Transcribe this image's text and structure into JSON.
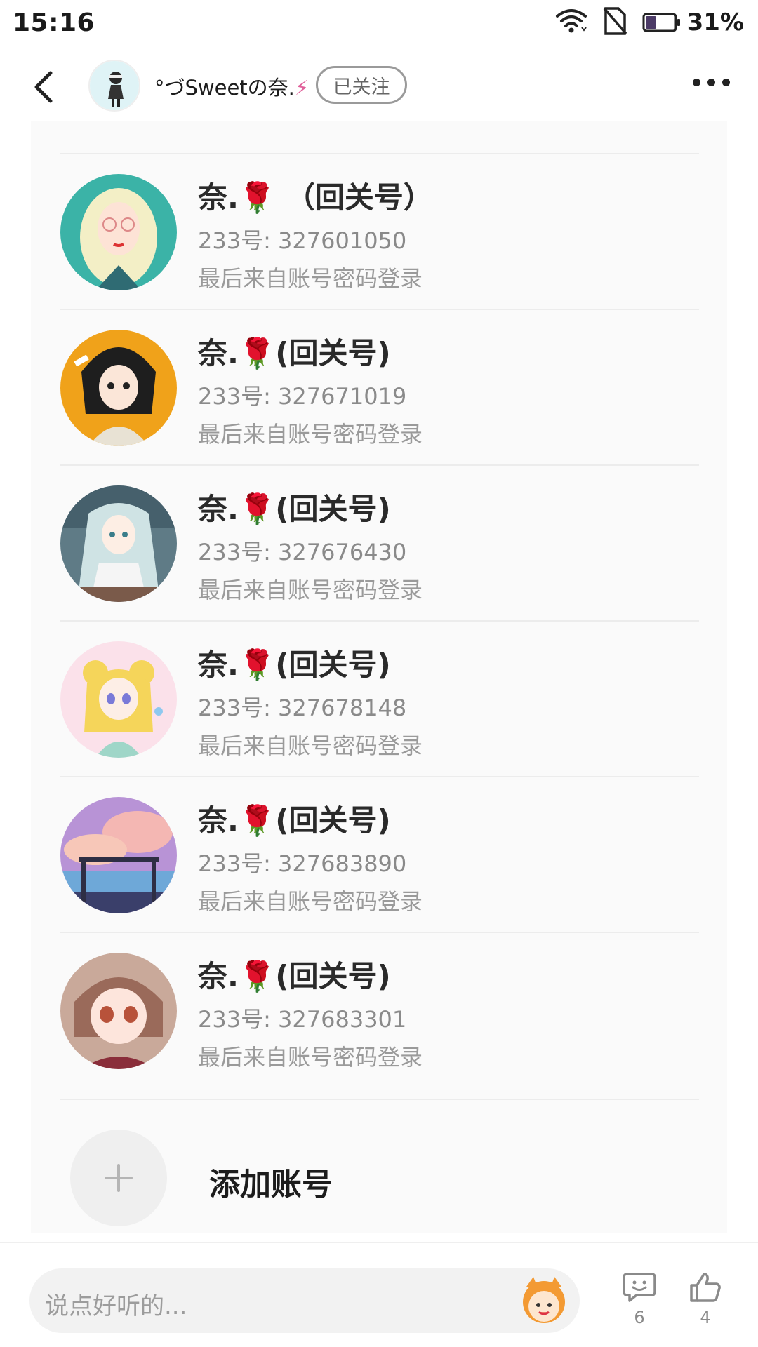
{
  "status_bar": {
    "time": "15:16",
    "battery_percent": "31%",
    "battery_level": 0.31,
    "icons": [
      "wifi-icon",
      "no-sim-icon",
      "battery-icon"
    ]
  },
  "header": {
    "user_name": "°づSweetの奈.",
    "follow_label": "已关注",
    "icons": [
      "back-arrow-icon",
      "more-dots-icon"
    ]
  },
  "accounts": [
    {
      "name": "奈.",
      "name_suffix": " （回关号）",
      "id_line": "233号: 327601050",
      "login": "最后来自账号密码登录",
      "avatar_color": "#3bb3a7"
    },
    {
      "name": "奈.",
      "name_suffix": "(回关号)",
      "id_line": "233号: 327671019",
      "login": "最后来自账号密码登录",
      "avatar_color": "#f0a21a"
    },
    {
      "name": "奈.",
      "name_suffix": "(回关号)",
      "id_line": "233号: 327676430",
      "login": "最后来自账号密码登录",
      "avatar_color": "#5f7b86"
    },
    {
      "name": "奈.",
      "name_suffix": "(回关号)",
      "id_line": "233号: 327678148",
      "login": "最后来自账号密码登录",
      "avatar_color": "#f7c2d6"
    },
    {
      "name": "奈.",
      "name_suffix": "(回关号)",
      "id_line": "233号: 327683890",
      "login": "最后来自账号密码登录",
      "avatar_color": "#b893d6"
    },
    {
      "name": "奈.",
      "name_suffix": "(回关号)",
      "id_line": "233号: 327683301",
      "login": "最后来自账号密码登录",
      "avatar_color": "#c07a7a"
    }
  ],
  "add_account": {
    "label": "添加账号"
  },
  "bottom_bar": {
    "placeholder": "说点好听的...",
    "comment_count": "6",
    "like_count": "4"
  },
  "colors": {
    "rose": "#d01818",
    "card_bg": "#fafafa",
    "text_primary": "#2a2a2a",
    "text_secondary": "#8a8a8a"
  }
}
